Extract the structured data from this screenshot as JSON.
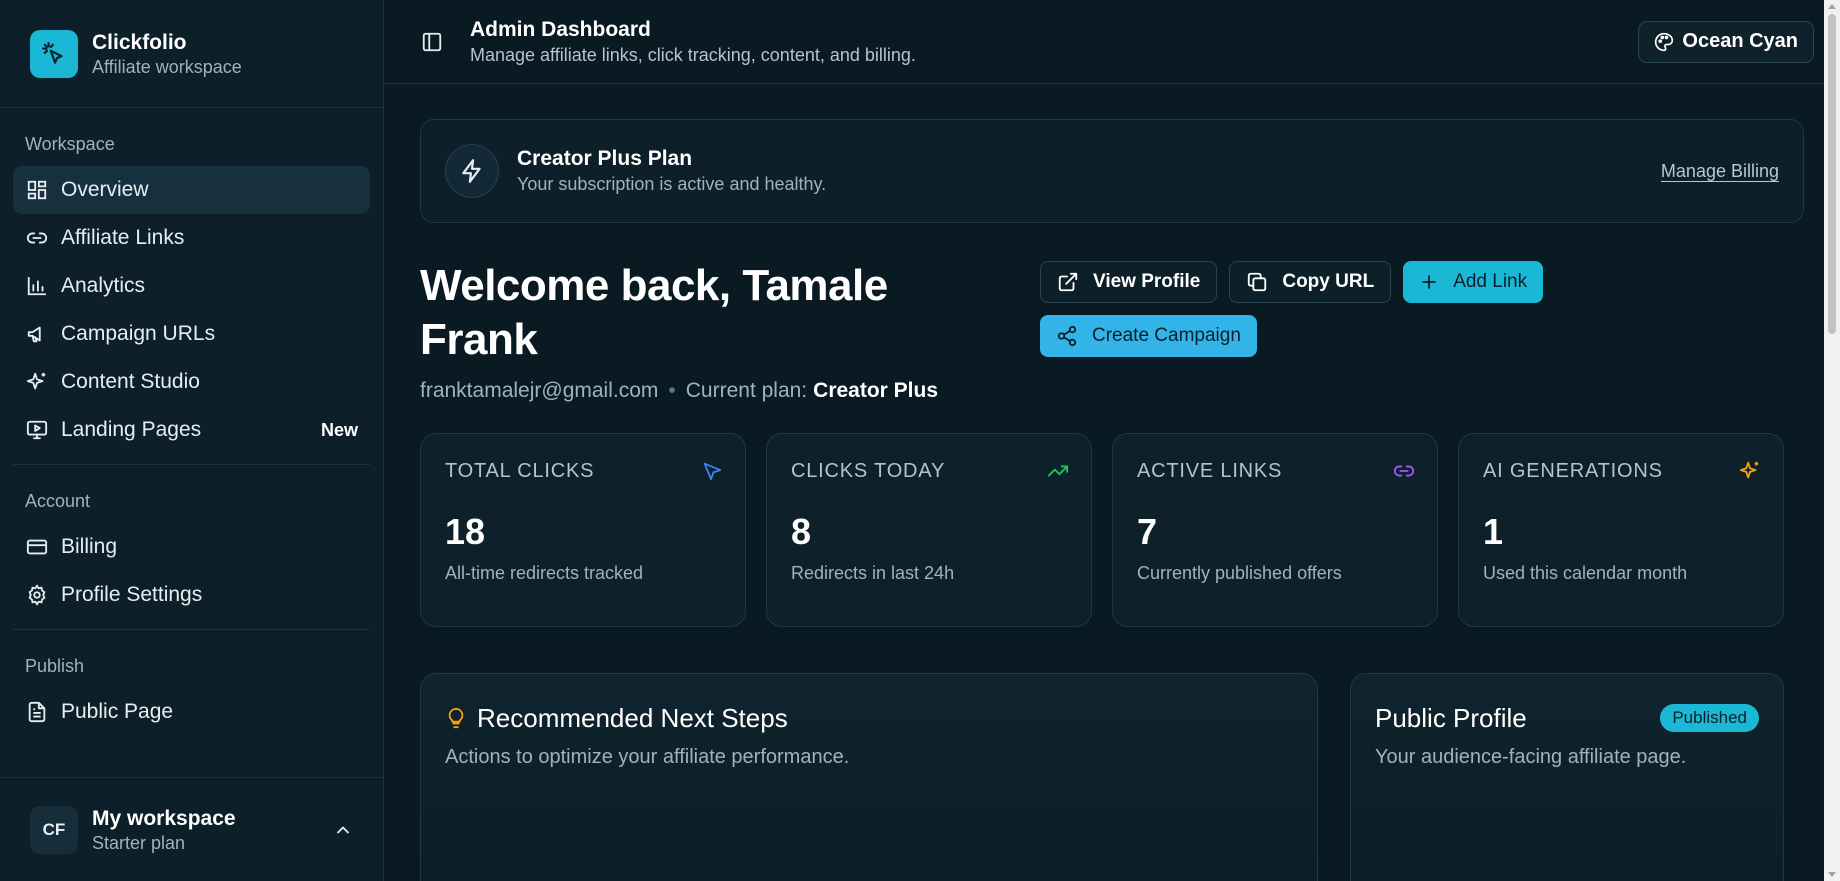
{
  "brand": {
    "name": "Clickfolio",
    "subtitle": "Affiliate workspace"
  },
  "sidebar": {
    "sections": [
      {
        "label": "Workspace"
      },
      {
        "label": "Account"
      },
      {
        "label": "Publish"
      }
    ],
    "items": [
      {
        "label": "Overview",
        "icon": "overview-icon"
      },
      {
        "label": "Affiliate Links",
        "icon": "link-icon"
      },
      {
        "label": "Analytics",
        "icon": "bar-chart-icon"
      },
      {
        "label": "Campaign URLs",
        "icon": "megaphone-icon"
      },
      {
        "label": "Content Studio",
        "icon": "sparkles-icon"
      },
      {
        "label": "Landing Pages",
        "icon": "presentation-icon",
        "badge": "New"
      },
      {
        "label": "Billing",
        "icon": "credit-card-icon"
      },
      {
        "label": "Profile Settings",
        "icon": "gear-icon"
      },
      {
        "label": "Public Page",
        "icon": "document-icon"
      }
    ],
    "workspace": {
      "initials": "CF",
      "name": "My workspace",
      "plan": "Starter plan"
    }
  },
  "header": {
    "title": "Admin Dashboard",
    "subtitle": "Manage affiliate links, click tracking, content, and billing.",
    "theme_label": "Ocean Cyan"
  },
  "plan_banner": {
    "title": "Creator Plus Plan",
    "subtitle": "Your subscription is active and healthy.",
    "link": "Manage Billing"
  },
  "welcome": {
    "title": "Welcome back, Tamale Frank",
    "email": "franktamalejr@gmail.com",
    "plan_label": "Current plan:",
    "plan_value": "Creator Plus"
  },
  "actions": {
    "view_profile": "View Profile",
    "copy_url": "Copy URL",
    "add_link": "Add Link",
    "create_campaign": "Create Campaign"
  },
  "stats": [
    {
      "label": "Total Clicks",
      "value": "18",
      "sub": "All-time redirects tracked",
      "icon": "cursor-icon",
      "color": "#3b82f6"
    },
    {
      "label": "Clicks Today",
      "value": "8",
      "sub": "Redirects in last 24h",
      "icon": "trending-up-icon",
      "color": "#22c55e"
    },
    {
      "label": "Active Links",
      "value": "7",
      "sub": "Currently published offers",
      "icon": "link-icon",
      "color": "#a855f7"
    },
    {
      "label": "AI Generations",
      "value": "1",
      "sub": "Used this calendar month",
      "icon": "sparkles-icon",
      "color": "#f59e0b"
    }
  ],
  "next_steps": {
    "title": "Recommended Next Steps",
    "subtitle": "Actions to optimize your affiliate performance."
  },
  "public_profile": {
    "title": "Public Profile",
    "badge": "Published",
    "subtitle": "Your audience-facing affiliate page."
  },
  "colors": {
    "accent": "#1bb8d6",
    "background": "#0a1a22",
    "sidebar": "#0d1f28"
  }
}
